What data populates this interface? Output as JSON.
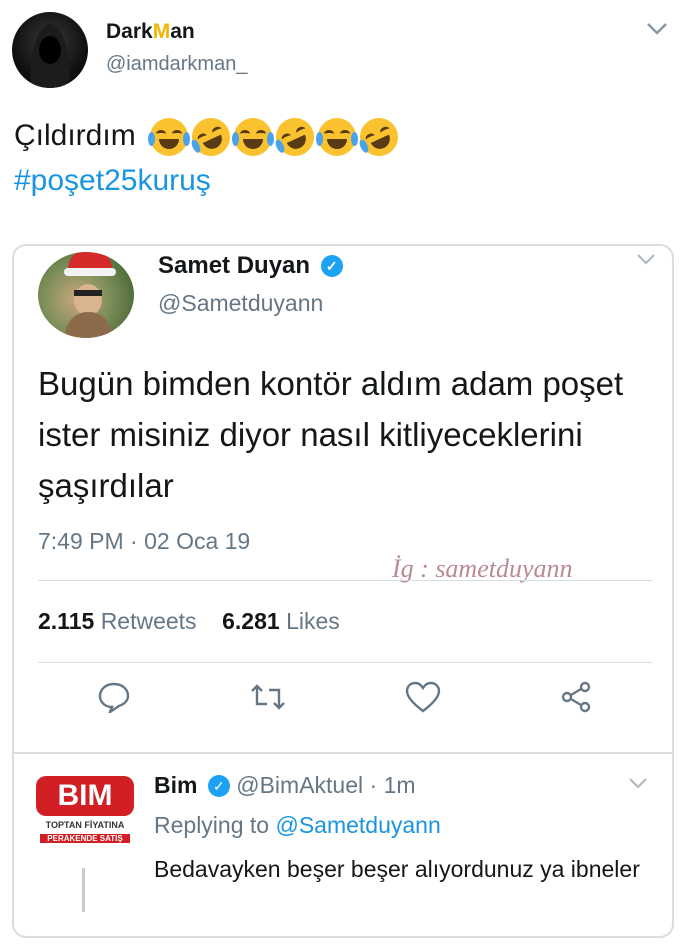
{
  "tweet": {
    "author": {
      "name_part1": "Dark",
      "name_mid": "M",
      "name_part2": "an",
      "handle": "@iamdarkman_"
    },
    "text": "Çıldırdım",
    "emojis": [
      "joy-emoji",
      "rofl-emoji",
      "joy-emoji",
      "rofl-emoji",
      "joy-emoji",
      "rofl-emoji"
    ],
    "hashtag": "#poşet25kuruş"
  },
  "quoted": {
    "author": {
      "name": "Samet Duyan",
      "handle": "@Sametduyann",
      "verified": true
    },
    "text": "Bugün bimden kontör aldım adam poşet ister misiniz diyor nasıl kitliyeceklerini şaşırdılar",
    "timestamp": "7:49 PM · 02 Oca 19",
    "watermark": "İg : sametduyann",
    "retweets_count": "2.115",
    "retweets_label": "Retweets",
    "likes_count": "6.281",
    "likes_label": "Likes"
  },
  "reply": {
    "author": {
      "name": "Bim",
      "handle": "@BimAktuel",
      "time": "· 1m",
      "verified": true
    },
    "logo": {
      "text": "BIM",
      "line1": "TOPTAN FİYATINA",
      "line2": "PERAKENDE SATIŞ"
    },
    "replying_prefix": "Replying to",
    "replying_to": "@Sametduyann",
    "text": "Bedavayken beşer beşer alıyordunuz ya ibneler"
  },
  "colors": {
    "accent": "#1b95e0",
    "verified": "#1da1f2",
    "bim_red": "#d21f26",
    "muted": "#657786"
  }
}
